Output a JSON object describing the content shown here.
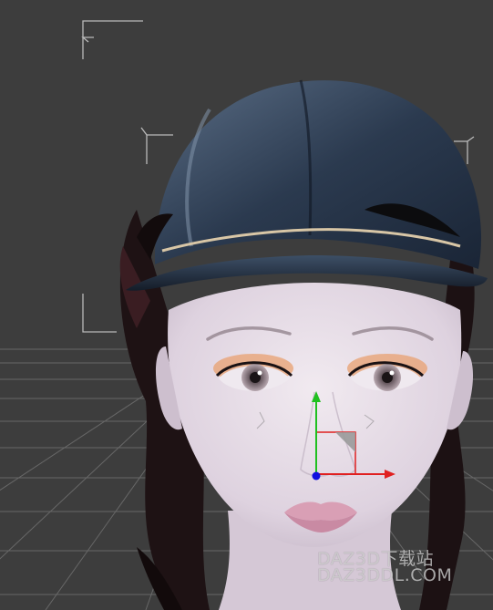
{
  "viewport": {
    "background_color": "#3d3d3d",
    "grid_color": "#8a8a8a",
    "selection_bracket_color": "#d0d0d0",
    "object": "hair-and-cap-on-figure"
  },
  "manipulator": {
    "x_axis_color": "#e02020",
    "y_axis_color": "#20c020",
    "z_axis_color": "#1010e0"
  },
  "watermark": {
    "line1": "DAZ3D下载站",
    "line2": "DAZ3DDL.COM"
  }
}
